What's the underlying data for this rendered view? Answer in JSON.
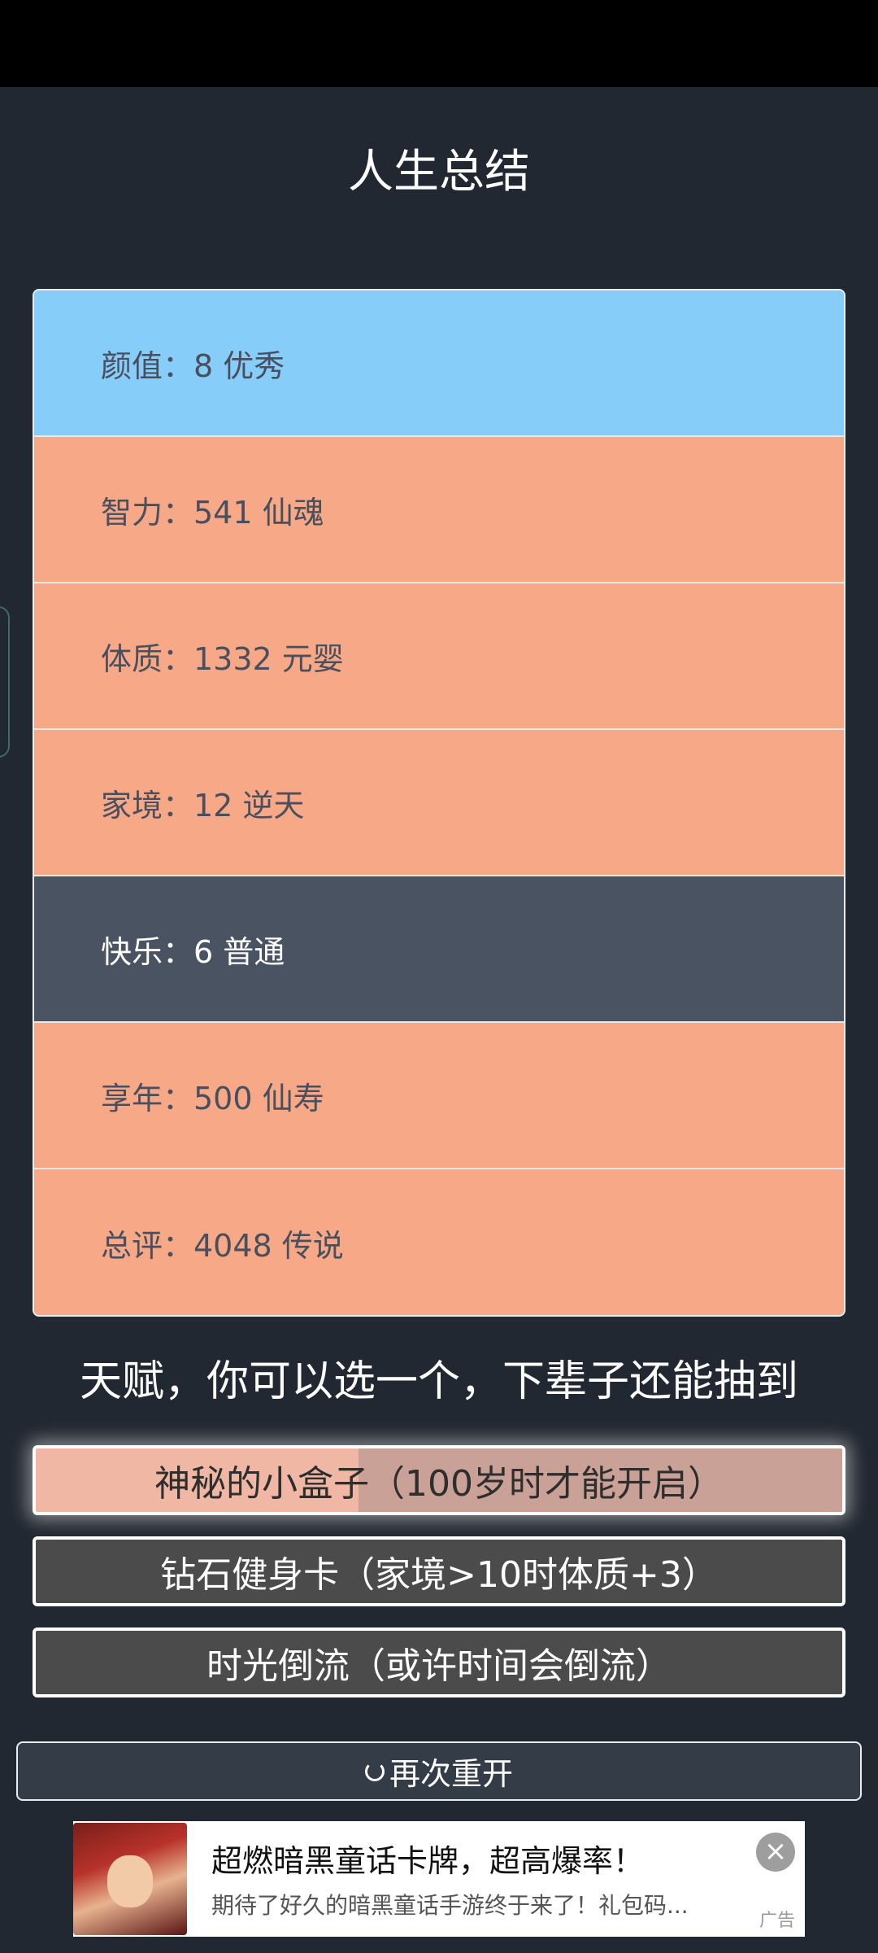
{
  "page": {
    "title": "人生总结"
  },
  "stats": [
    {
      "label": "颜值：8 优秀",
      "tone": "blue"
    },
    {
      "label": "智力：541 仙魂",
      "tone": "orange"
    },
    {
      "label": "体质：1332 元婴",
      "tone": "orange"
    },
    {
      "label": "家境：12 逆天",
      "tone": "orange"
    },
    {
      "label": "快乐：6 普通",
      "tone": "dark"
    },
    {
      "label": "享年：500 仙寿",
      "tone": "orange"
    },
    {
      "label": "总评：4048 传说",
      "tone": "orange"
    }
  ],
  "talents": {
    "heading": "天赋，你可以选一个，下辈子还能抽到",
    "items": [
      {
        "label": "神秘的小盒子（100岁时才能开启）",
        "selected": true
      },
      {
        "label": "钻石健身卡（家境>10时体质+3）",
        "selected": false
      },
      {
        "label": "时光倒流（或许时间会倒流）",
        "selected": false
      }
    ]
  },
  "restart": {
    "label": "再次重开",
    "icon": "refresh-icon"
  },
  "ad": {
    "title": "超燃暗黑童话卡牌，超高爆率！",
    "description": "期待了好久的暗黑童话手游终于来了！礼包码...",
    "badge": "广告",
    "close_icon": "close-icon"
  },
  "colors": {
    "background": "#222831",
    "stat_blue": "#87cdf9",
    "stat_orange": "#f7a987",
    "stat_dark": "#4a5362",
    "talent_bg": "#4b4b4b"
  }
}
